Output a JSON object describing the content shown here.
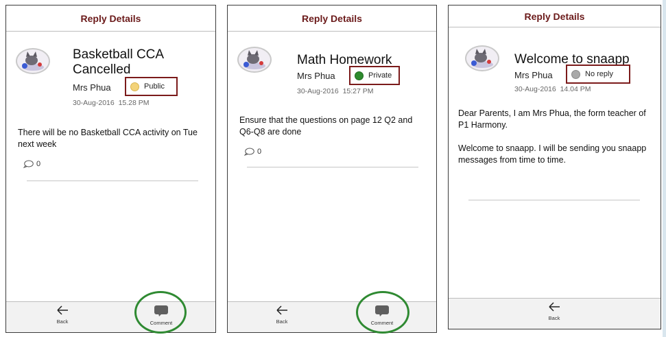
{
  "colors": {
    "header_text": "#6b1a1a",
    "highlight_box": "#7b1a1a",
    "ring": "#2f8a32",
    "public_dot": "#f3d37a",
    "private_dot": "#2e8b2e",
    "noreply_dot": "#a9a9a9"
  },
  "screens": [
    {
      "header": "Reply Details",
      "title_line1": "Basketball CCA",
      "title_line2": "Cancelled",
      "author": "Mrs Phua",
      "visibility": "Public",
      "date": "30-Aug-2016",
      "time": "15.28 PM",
      "body": [
        "There will be no Basketball CCA activity on Tue next week"
      ],
      "comment_count": "0",
      "back_label": "Back",
      "comment_label": "Comment"
    },
    {
      "header": "Reply Details",
      "title_line1": "Math Homework",
      "author": "Mrs Phua",
      "visibility": "Private",
      "date": "30-Aug-2016",
      "time": "15:27 PM",
      "body": [
        "Ensure that the questions on page 12 Q2 and Q6-Q8 are done"
      ],
      "comment_count": "0",
      "back_label": "Back",
      "comment_label": "Comment"
    },
    {
      "header": "Reply Details",
      "title_line1": "Welcome to snaapp",
      "author": "Mrs Phua",
      "visibility": "No reply",
      "date": "30-Aug-2016",
      "time": "14.04 PM",
      "body": [
        "Dear Parents, I am Mrs Phua, the form teacher of P1 Harmony.",
        "Welcome to snaapp. I will be sending you snaapp messages from time to time."
      ],
      "back_label": "Back"
    }
  ]
}
